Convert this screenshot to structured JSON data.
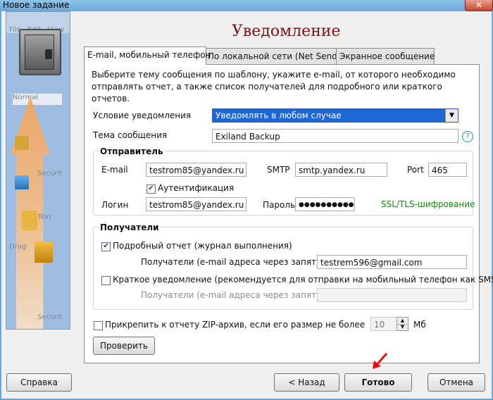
{
  "window": {
    "title": "Новое задание",
    "close": "✕"
  },
  "left_panel": {
    "ghost_menu": [
      "File",
      "Edit",
      "View"
    ],
    "ghost_field": "Normal",
    "ghost_items": [
      "Securit",
      "Text",
      "Securit",
      "Drag"
    ]
  },
  "header": {
    "title": "Уведомление"
  },
  "tabs": [
    {
      "label": "E-mail, мобильный телефон",
      "active": true
    },
    {
      "label": "По локальной сети (Net Send)",
      "active": false
    },
    {
      "label": "Экранное сообщение",
      "active": false
    }
  ],
  "description": "Выберите тему сообщения по шаблону, укажите e-mail, от которого необходимо отправлять отчет, а также список получателей для подробного или краткого отчетов.",
  "condition": {
    "label": "Условие уведомления",
    "value": "Уведомлять в любом случае"
  },
  "subject": {
    "label": "Тема сообщения",
    "value": "Exiland Backup"
  },
  "help_icon": "?",
  "sender": {
    "title": "Отправитель",
    "email_label": "E-mail",
    "email_value": "testrom85@yandex.ru",
    "smtp_label": "SMTP",
    "smtp_value": "smtp.yandex.ru",
    "port_label": "Port",
    "port_value": "465",
    "auth_label": "Аутентификация",
    "auth_checked": true,
    "login_label": "Логин",
    "login_value": "testrom85@yandex.ru",
    "password_label": "Пароль",
    "password_value": "●●●●●●●●●●●●",
    "ssl_label": "SSL/TLS-шифрование"
  },
  "recipients": {
    "title": "Получатели",
    "detailed_label": "Подробный отчет (журнал выполнения)",
    "detailed_checked": true,
    "detailed_recipients_label": "Получатели (e-mail адреса через запятую)",
    "detailed_recipients_value": "testrem596@gmail.com",
    "short_label": "Краткое уведомление (рекомендуется для отправки на мобильный телефон как SMS)",
    "short_checked": false,
    "short_recipients_label": "Получатели (e-mail адреса через запятую)",
    "short_recipients_value": ""
  },
  "zip": {
    "label": "Прикрепить к отчету ZIP-архив, если его размер не более",
    "checked": false,
    "value": "10",
    "unit": "Мб"
  },
  "check_button": "Проверить",
  "footer": {
    "help": "Справка",
    "back": "< Назад",
    "done": "Готово",
    "cancel": "Отмена"
  },
  "colors": {
    "accent_blue": "#1e67d6",
    "title_red": "#7a1515",
    "ssl_green": "#128a12",
    "annotation_arrow": "#e01010"
  }
}
